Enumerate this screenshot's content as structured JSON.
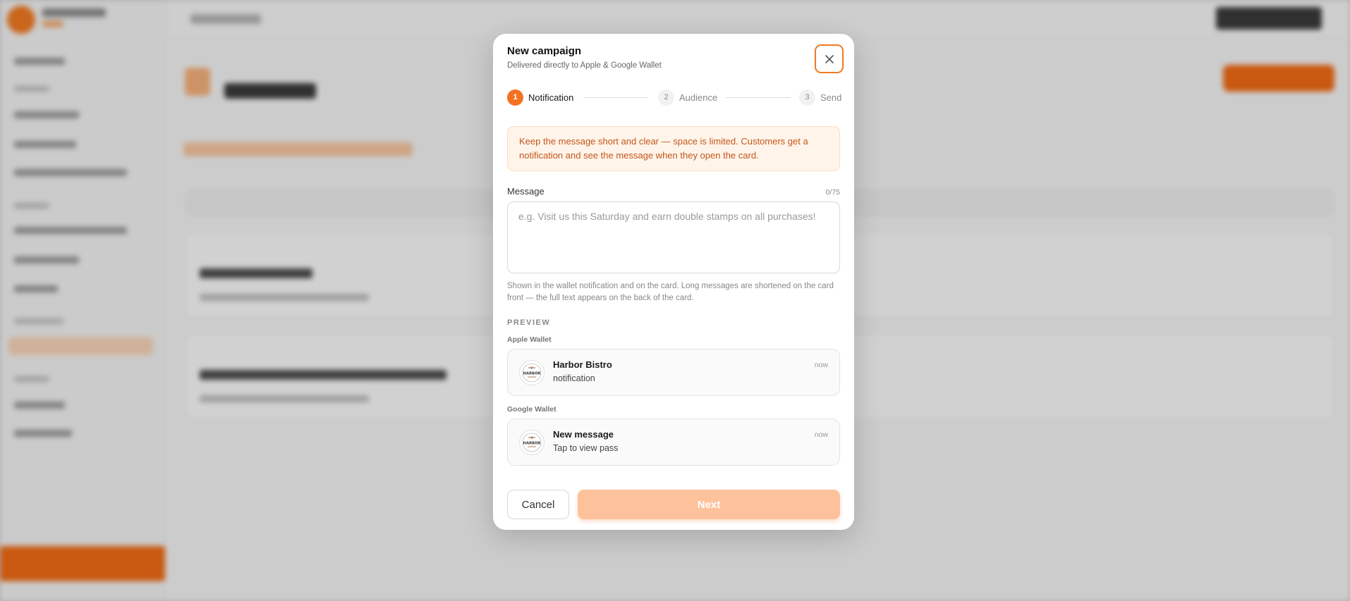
{
  "modal": {
    "title": "New campaign",
    "subtitle": "Delivered directly to Apple & Google Wallet",
    "close_icon": "close-icon"
  },
  "steps": [
    {
      "number": "1",
      "label": "Notification",
      "active": true
    },
    {
      "number": "2",
      "label": "Audience",
      "active": false
    },
    {
      "number": "3",
      "label": "Send",
      "active": false
    }
  ],
  "info_text": "Keep the message short and clear — space is limited. Customers get a notification and see the message when they open the card.",
  "message_field": {
    "label": "Message",
    "counter": "0/75",
    "value": "",
    "placeholder": "e.g. Visit us this Saturday and earn double stamps on all purchases!",
    "help": "Shown in the wallet notification and on the card. Long messages are shortened on the card front — the full text appears on the back of the card."
  },
  "preview": {
    "heading": "PREVIEW",
    "apple": {
      "label": "Apple Wallet",
      "title": "Harbor Bistro",
      "text": "notification",
      "time": "now",
      "logo_text": "HARBOR"
    },
    "google": {
      "label": "Google Wallet",
      "title": "New message",
      "text": "Tap to view pass",
      "time": "now",
      "logo_text": "HARBOR"
    }
  },
  "buttons": {
    "cancel": "Cancel",
    "next": "Next"
  },
  "colors": {
    "accent": "#f37121",
    "info_bg": "#fff4ea",
    "info_text": "#c4561a",
    "next_disabled": "#fdc29c"
  }
}
